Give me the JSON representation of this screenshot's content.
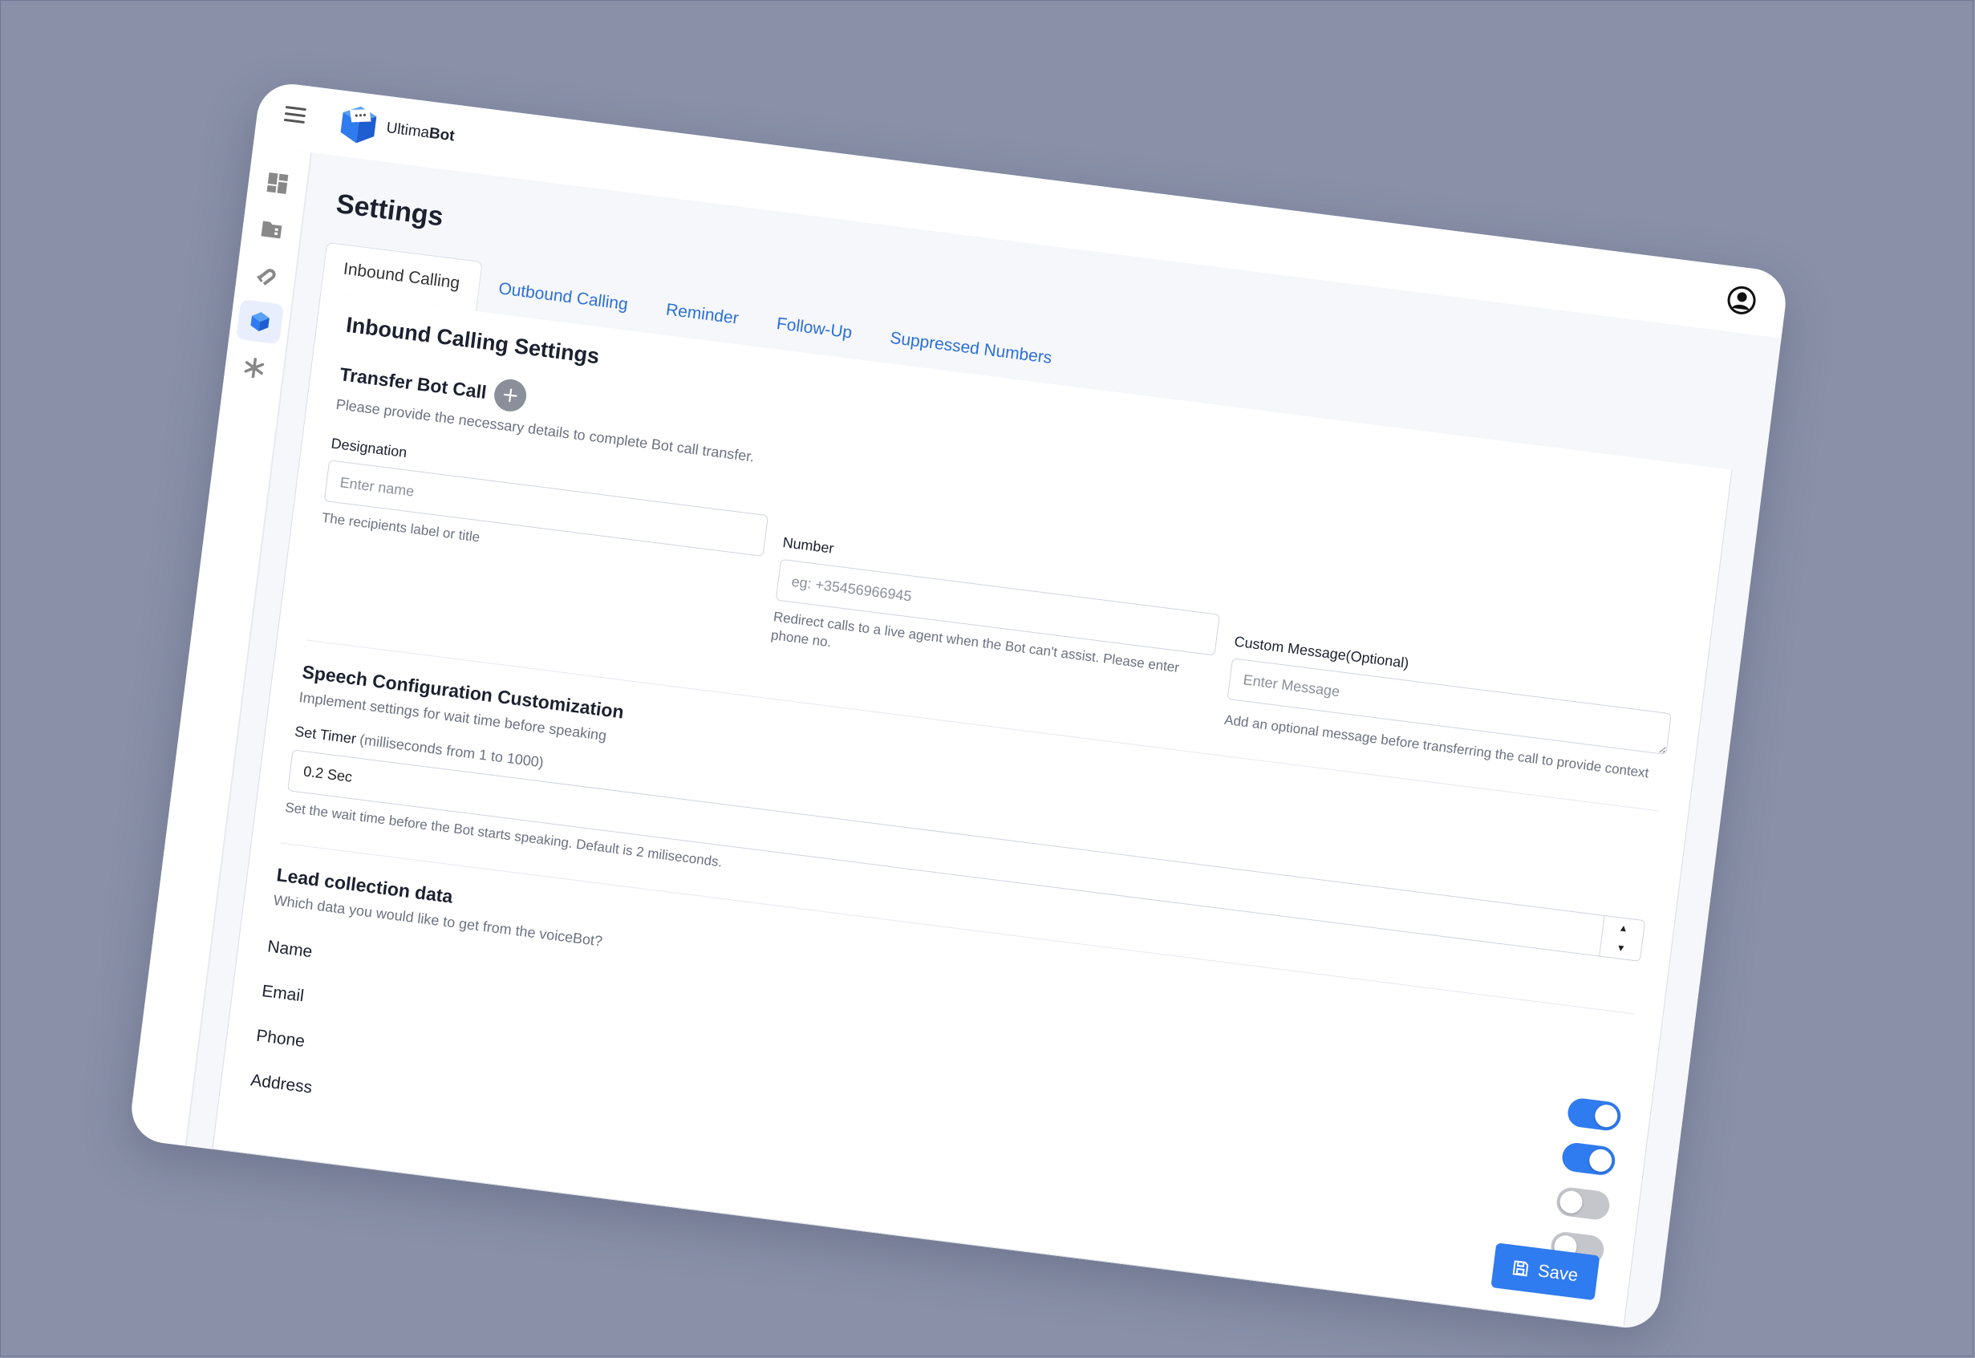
{
  "app": {
    "brand_light": "Ultima",
    "brand_bold": "Bot"
  },
  "colors": {
    "accent": "#2f7bf0",
    "toggle_off": "#c4c6cb",
    "background": "#8990a8"
  },
  "sidebar": {
    "items": [
      {
        "icon": "dashboard-icon",
        "active": false
      },
      {
        "icon": "folder-icon",
        "active": false
      },
      {
        "icon": "magnet-icon",
        "active": false
      },
      {
        "icon": "cube-icon",
        "active": true
      },
      {
        "icon": "asterisk-icon",
        "active": false
      }
    ]
  },
  "page": {
    "title": "Settings"
  },
  "tabs": [
    {
      "label": "Inbound Calling",
      "active": true
    },
    {
      "label": "Outbound Calling",
      "active": false
    },
    {
      "label": "Reminder",
      "active": false
    },
    {
      "label": "Follow-Up",
      "active": false
    },
    {
      "label": "Suppressed Numbers",
      "active": false
    }
  ],
  "inbound": {
    "title": "Inbound Calling Settings",
    "transfer": {
      "title": "Transfer Bot Call",
      "add_label": "+",
      "description": "Please provide the necessary details to complete Bot call transfer.",
      "designation": {
        "label": "Designation",
        "placeholder": "Enter name",
        "hint": "The recipients label or title"
      },
      "number": {
        "label": "Number",
        "placeholder": "eg: +35456966945",
        "hint": "Redirect calls to a live agent when the Bot can't assist. Please enter phone no."
      },
      "custom_message": {
        "label": "Custom Message(Optional)",
        "placeholder": "Enter Message",
        "hint": "Add an optional message before transferring the call to provide context"
      }
    },
    "speech": {
      "title": "Speech Configuration Customization",
      "description": "Implement settings for wait time before speaking",
      "timer_label": "Set Timer",
      "timer_label_muted": "(milliseconds from 1 to 1000)",
      "timer_value": "0.2 Sec",
      "timer_hint": "Set the wait time before the Bot starts speaking. Default is 2 miliseconds."
    },
    "lead": {
      "title": "Lead collection data",
      "description": "Which data you would like to get from the voiceBot?",
      "items": [
        {
          "label": "Name",
          "enabled": true
        },
        {
          "label": "Email",
          "enabled": true
        },
        {
          "label": "Phone",
          "enabled": false
        },
        {
          "label": "Address",
          "enabled": false
        }
      ]
    },
    "save_label": "Save"
  }
}
